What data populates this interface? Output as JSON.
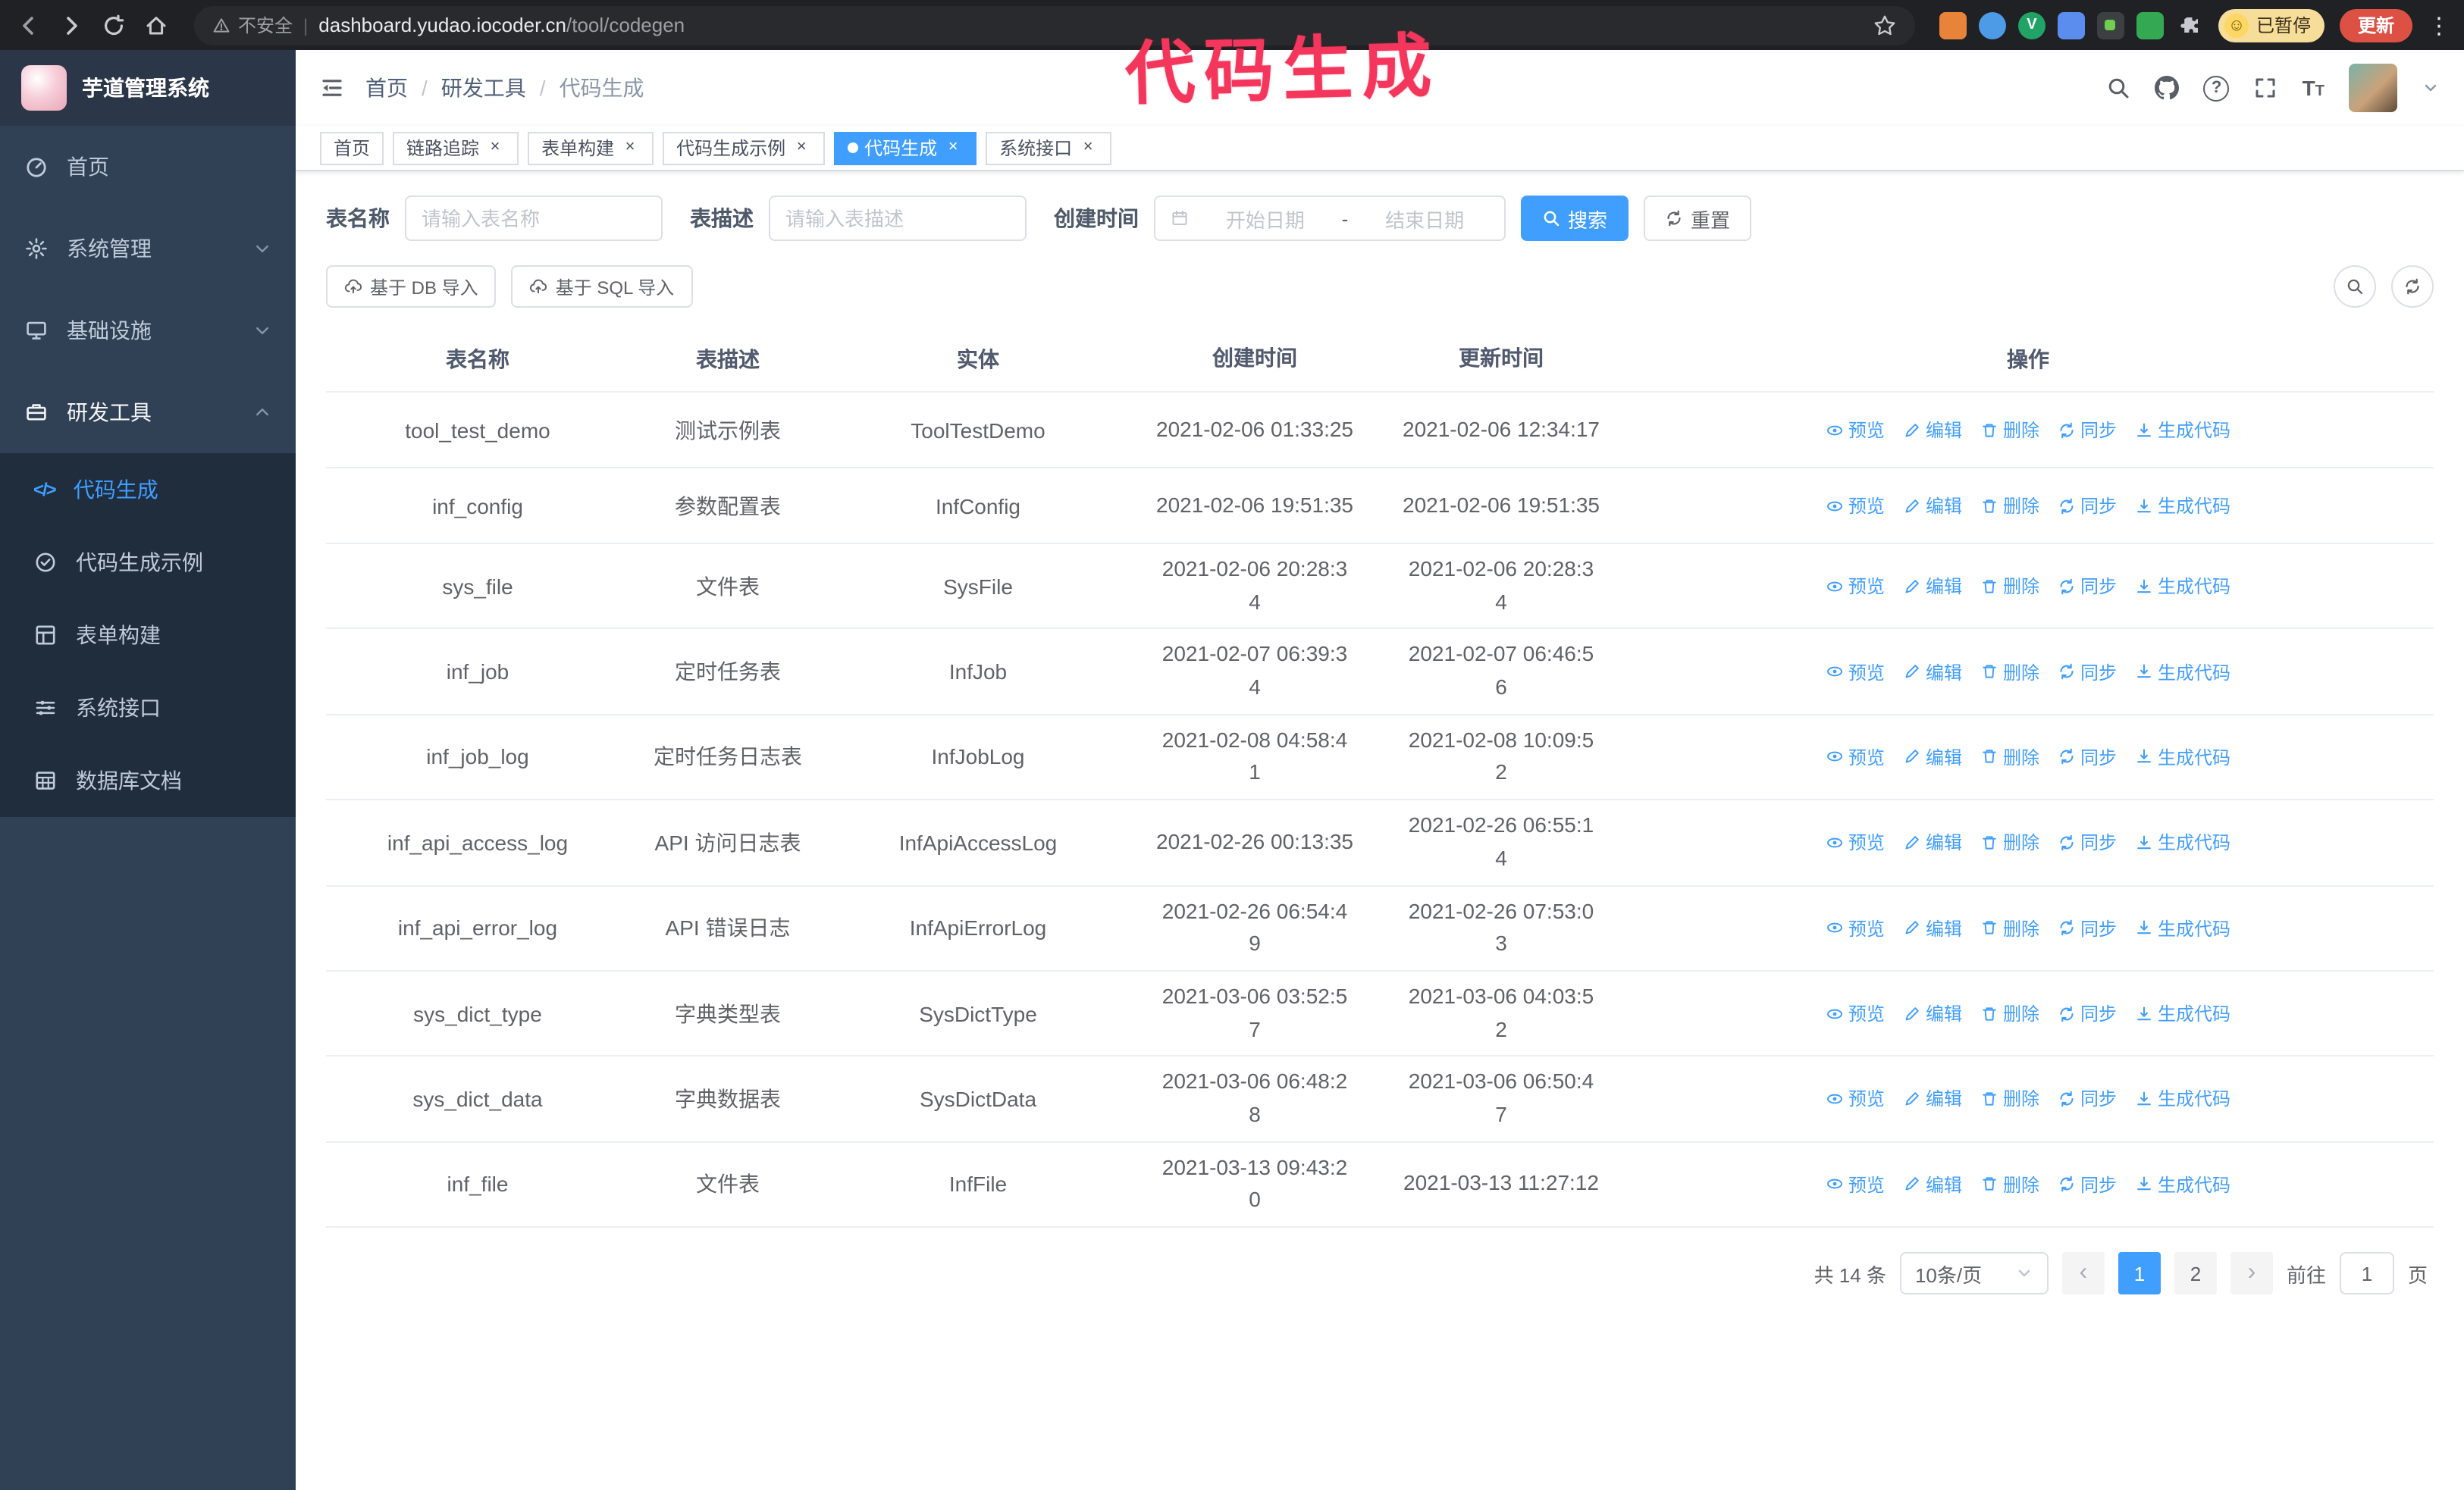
{
  "annotation": {
    "text": "代码生成"
  },
  "colors": {
    "accent": "#409eff",
    "annotation": "#f5365c",
    "sidebar_bg": "#304156",
    "submenu_bg": "#1f2d3d"
  },
  "browser": {
    "insecure_label": "不安全",
    "url_domain": "dashboard.yudao.iocoder.cn",
    "url_path": "/tool/codegen",
    "paused_badge": "已暂停",
    "update_button": "更新"
  },
  "sidebar": {
    "logo_title": "芋道管理系统",
    "items": [
      {
        "label": "首页"
      },
      {
        "label": "系统管理"
      },
      {
        "label": "基础设施"
      },
      {
        "label": "研发工具"
      }
    ],
    "submenu": [
      {
        "label": "代码生成"
      },
      {
        "label": "代码生成示例"
      },
      {
        "label": "表单构建"
      },
      {
        "label": "系统接口"
      },
      {
        "label": "数据库文档"
      }
    ]
  },
  "header": {
    "breadcrumb": [
      "首页",
      "研发工具",
      "代码生成"
    ],
    "separator": "/"
  },
  "tabs": [
    {
      "label": "首页",
      "closable": false
    },
    {
      "label": "链路追踪",
      "closable": true
    },
    {
      "label": "表单构建",
      "closable": true
    },
    {
      "label": "代码生成示例",
      "closable": true
    },
    {
      "label": "代码生成",
      "closable": true,
      "active": true
    },
    {
      "label": "系统接口",
      "closable": true
    }
  ],
  "filters": {
    "table_name_label": "表名称",
    "table_name_placeholder": "请输入表名称",
    "table_desc_label": "表描述",
    "table_desc_placeholder": "请输入表描述",
    "create_time_label": "创建时间",
    "date_start_placeholder": "开始日期",
    "date_separator": "-",
    "date_end_placeholder": "结束日期",
    "search_button": "搜索",
    "reset_button": "重置"
  },
  "toolbar": {
    "import_db": "基于 DB 导入",
    "import_sql": "基于 SQL 导入"
  },
  "table": {
    "columns": [
      "表名称",
      "表描述",
      "实体",
      "创建时间",
      "更新时间",
      "操作"
    ],
    "actions": [
      "预览",
      "编辑",
      "删除",
      "同步",
      "生成代码"
    ],
    "rows": [
      {
        "name": "tool_test_demo",
        "desc": "测试示例表",
        "entity": "ToolTestDemo",
        "created": "2021-02-06 01:33:25",
        "updated": "2021-02-06 12:34:17"
      },
      {
        "name": "inf_config",
        "desc": "参数配置表",
        "entity": "InfConfig",
        "created": "2021-02-06 19:51:35",
        "updated": "2021-02-06 19:51:35"
      },
      {
        "name": "sys_file",
        "desc": "文件表",
        "entity": "SysFile",
        "created": "2021-02-06 20:28:3\n4",
        "updated": "2021-02-06 20:28:3\n4"
      },
      {
        "name": "inf_job",
        "desc": "定时任务表",
        "entity": "InfJob",
        "created": "2021-02-07 06:39:3\n4",
        "updated": "2021-02-07 06:46:5\n6"
      },
      {
        "name": "inf_job_log",
        "desc": "定时任务日志表",
        "entity": "InfJobLog",
        "created": "2021-02-08 04:58:4\n1",
        "updated": "2021-02-08 10:09:5\n2"
      },
      {
        "name": "inf_api_access_log",
        "desc": "API 访问日志表",
        "entity": "InfApiAccessLog",
        "created": "2021-02-26 00:13:35",
        "updated": "2021-02-26 06:55:1\n4"
      },
      {
        "name": "inf_api_error_log",
        "desc": "API 错误日志",
        "entity": "InfApiErrorLog",
        "created": "2021-02-26 06:54:4\n9",
        "updated": "2021-02-26 07:53:0\n3"
      },
      {
        "name": "sys_dict_type",
        "desc": "字典类型表",
        "entity": "SysDictType",
        "created": "2021-03-06 03:52:5\n7",
        "updated": "2021-03-06 04:03:5\n2"
      },
      {
        "name": "sys_dict_data",
        "desc": "字典数据表",
        "entity": "SysDictData",
        "created": "2021-03-06 06:48:2\n8",
        "updated": "2021-03-06 06:50:4\n7"
      },
      {
        "name": "inf_file",
        "desc": "文件表",
        "entity": "InfFile",
        "created": "2021-03-13 09:43:2\n0",
        "updated": "2021-03-13 11:27:12"
      }
    ]
  },
  "pagination": {
    "total": "共 14 条",
    "page_size": "10条/页",
    "pages": [
      "1",
      "2"
    ],
    "active_page": "1",
    "goto_label": "前往",
    "goto_value": "1",
    "page_unit": "页"
  }
}
